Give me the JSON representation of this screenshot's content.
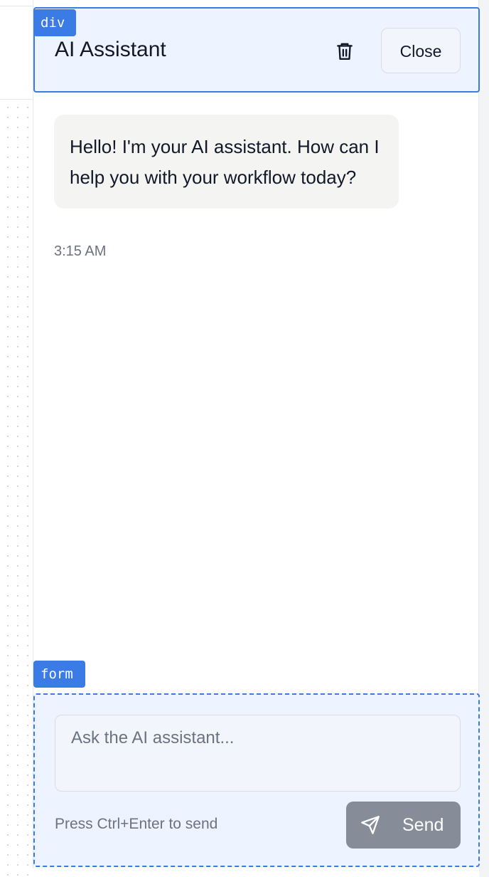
{
  "header": {
    "tag": "div",
    "title": "AI Assistant",
    "delete_icon": "trash-icon",
    "close_label": "Close"
  },
  "messages": [
    {
      "role": "assistant",
      "text": "Hello! I'm your AI assistant. How can I help you with your workflow today?",
      "time": "3:15 AM"
    }
  ],
  "form": {
    "tag": "form",
    "placeholder": "Ask the AI assistant...",
    "value": "",
    "hint": "Press Ctrl+Enter to send",
    "send_label": "Send",
    "send_icon": "send-icon"
  },
  "colors": {
    "accent": "#3b7be6",
    "header_bg": "#eef4ff",
    "bubble_bg": "#f4f4f3",
    "send_disabled_bg": "#878d98",
    "muted_text": "#6b7280"
  }
}
